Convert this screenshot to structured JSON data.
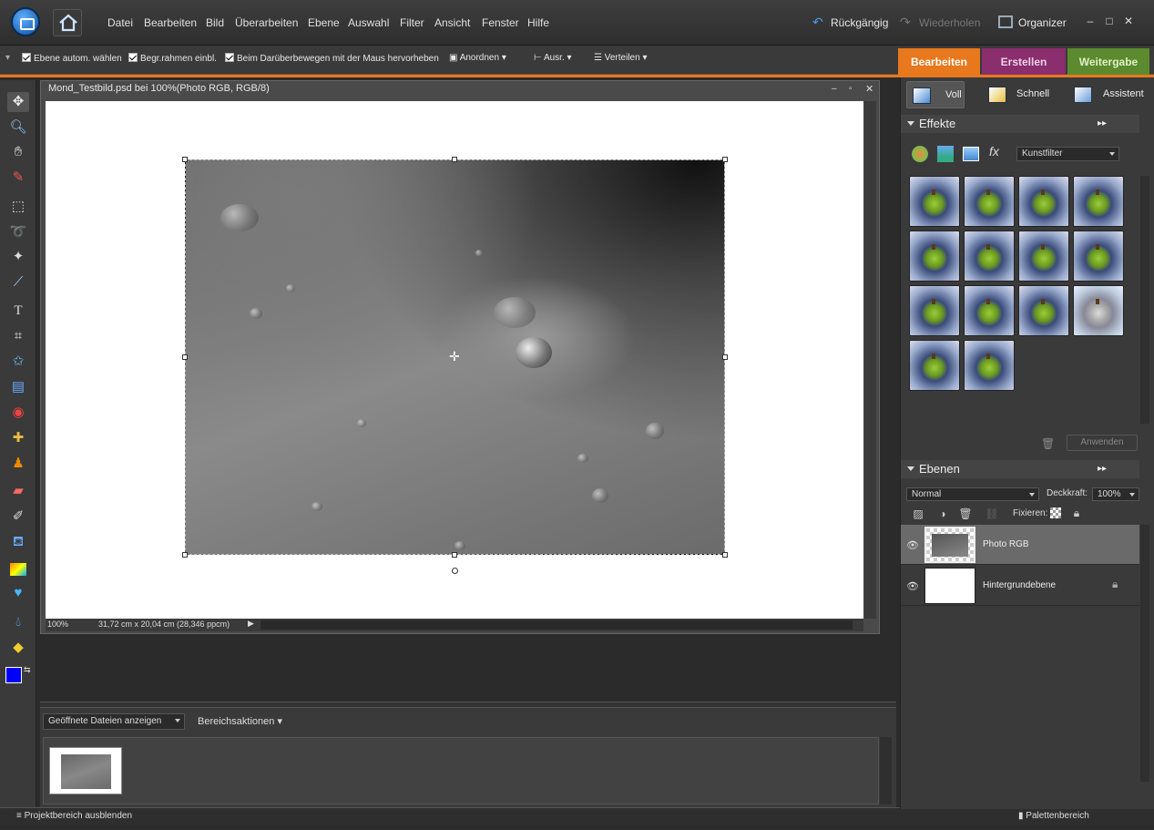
{
  "menubar": {
    "items": [
      "Datei",
      "Bearbeiten",
      "Bild",
      "Überarbeiten",
      "Ebene",
      "Auswahl",
      "Filter",
      "Ansicht",
      "Fenster",
      "Hilfe"
    ],
    "undo_label": "Rückgängig",
    "redo_label": "Wiederholen",
    "organizer_label": "Organizer"
  },
  "options_bar": {
    "auto_select_label": "Ebene autom. wählen",
    "bounding_box_label": "Begr.rahmen einbl.",
    "highlight_label": "Beim Darüberbewegen mit der Maus hervorheben",
    "arrange_label": "Anordnen",
    "align_label": "Ausr.",
    "distribute_label": "Verteilen"
  },
  "mode_tabs": [
    {
      "label": "Bearbeiten",
      "color": "#e8781d",
      "active": true
    },
    {
      "label": "Erstellen",
      "color": "#8a2e6e",
      "active": false
    },
    {
      "label": "Weitergabe",
      "color": "#5c8a2e",
      "active": false
    }
  ],
  "document": {
    "title": "Mond_Testbild.psd bei 100%(Photo RGB, RGB/8)",
    "zoom": "100%",
    "size_info": "31,72 cm x 20,04 cm (28,346 ppcm)"
  },
  "project_bin": {
    "show_open_files": "Geöffnete Dateien anzeigen",
    "area_actions": "Bereichsaktionen"
  },
  "statusbar": {
    "hide_project_bin": "Projektbereich ausblenden",
    "palette_bin": "Palettenbereich"
  },
  "edit_modes": {
    "full": "Voll",
    "quick": "Schnell",
    "guided": "Assistent"
  },
  "effects_panel": {
    "title": "Effekte",
    "category": "Kunstfilter",
    "apply_button": "Anwenden",
    "thumb_count": 14
  },
  "layers_panel": {
    "title": "Ebenen",
    "blend_mode": "Normal",
    "opacity_label": "Deckkraft:",
    "opacity_value": "100%",
    "lock_label": "Fixieren:",
    "layers": [
      {
        "name": "Photo RGB",
        "selected": true
      },
      {
        "name": "Hintergrundebene",
        "selected": false
      }
    ]
  },
  "colors": {
    "accent_orange": "#e8781d",
    "foreground": "#0000ff",
    "background": "#ffffff"
  }
}
